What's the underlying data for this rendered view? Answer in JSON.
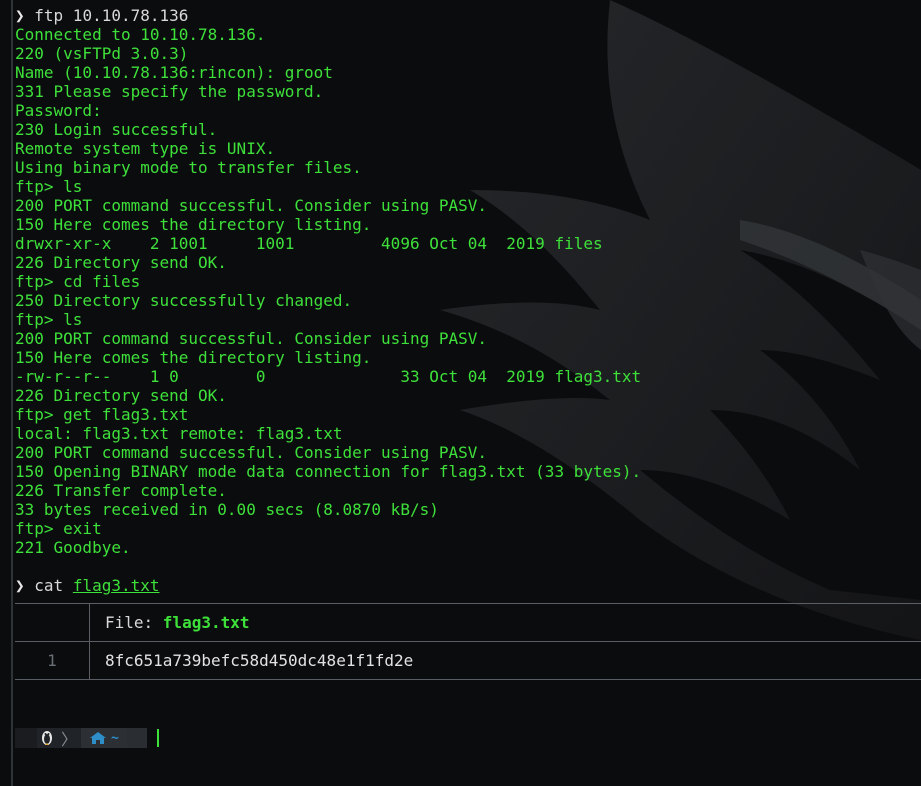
{
  "terminal": {
    "lines": [
      {
        "chevron": "❯",
        "cmd": " ftp 10.10.78.136"
      },
      {
        "text": "Connected to 10.10.78.136."
      },
      {
        "text": "220 (vsFTPd 3.0.3)"
      },
      {
        "text": "Name (10.10.78.136:rincon): groot"
      },
      {
        "text": "331 Please specify the password."
      },
      {
        "text": "Password:"
      },
      {
        "text": "230 Login successful."
      },
      {
        "text": "Remote system type is UNIX."
      },
      {
        "text": "Using binary mode to transfer files."
      },
      {
        "text": "ftp> ls"
      },
      {
        "text": "200 PORT command successful. Consider using PASV."
      },
      {
        "text": "150 Here comes the directory listing."
      },
      {
        "text": "drwxr-xr-x    2 1001     1001         4096 Oct 04  2019 files"
      },
      {
        "text": "226 Directory send OK."
      },
      {
        "text": "ftp> cd files"
      },
      {
        "text": "250 Directory successfully changed."
      },
      {
        "text": "ftp> ls"
      },
      {
        "text": "200 PORT command successful. Consider using PASV."
      },
      {
        "text": "150 Here comes the directory listing."
      },
      {
        "text": "-rw-r--r--    1 0        0              33 Oct 04  2019 flag3.txt"
      },
      {
        "text": "226 Directory send OK."
      },
      {
        "text": "ftp> get flag3.txt"
      },
      {
        "text": "local: flag3.txt remote: flag3.txt"
      },
      {
        "text": "200 PORT command successful. Consider using PASV."
      },
      {
        "text": "150 Opening BINARY mode data connection for flag3.txt (33 bytes)."
      },
      {
        "text": "226 Transfer complete."
      },
      {
        "text": "33 bytes received in 0.00 secs (8.0870 kB/s)"
      },
      {
        "text": "ftp> exit"
      },
      {
        "text": "221 Goodbye."
      }
    ],
    "cat_command": {
      "chevron": "❯",
      "cmd": "cat",
      "arg": "flag3.txt"
    }
  },
  "bat": {
    "header_label": "File: ",
    "header_filename": "flag3.txt",
    "rows": [
      {
        "line_number": "1",
        "content": "8fc651a739befc58d450dc48e1f1fd2e"
      }
    ]
  },
  "statusbar": {
    "os_icon": "linux-tux-icon",
    "home_icon": "home-icon",
    "path": "~"
  },
  "colors": {
    "terminal_green": "#3ee03a",
    "path_blue": "#2d8ec8",
    "background": "#0b0c0e"
  }
}
